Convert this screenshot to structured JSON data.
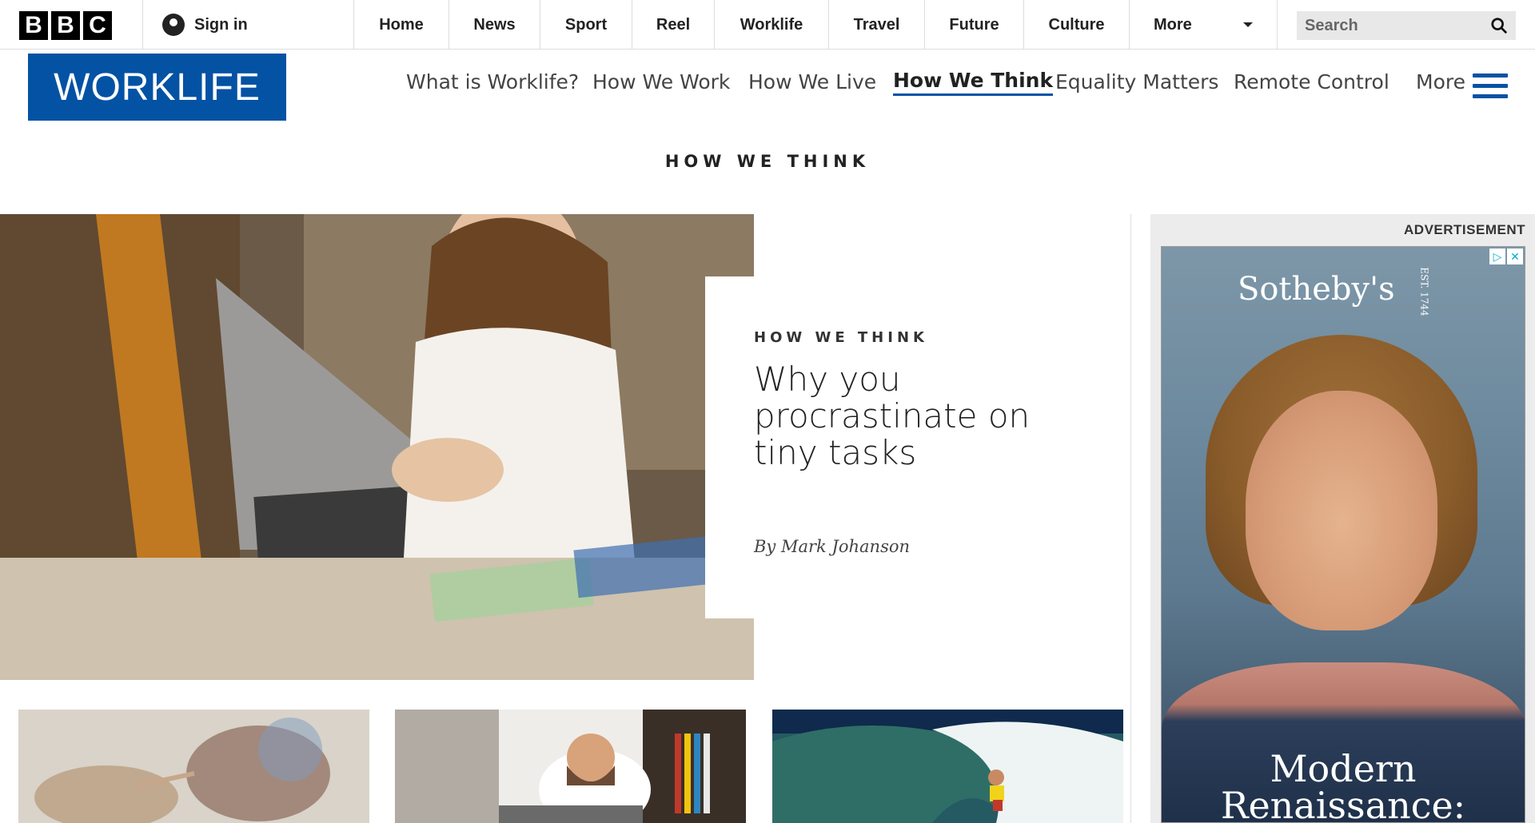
{
  "bbc_bar": {
    "logo_letters": [
      "B",
      "B",
      "C"
    ],
    "sign_in": "Sign in",
    "nav": [
      "Home",
      "News",
      "Sport",
      "Reel",
      "Worklife",
      "Travel",
      "Future",
      "Culture"
    ],
    "more": "More",
    "search_placeholder": "Search"
  },
  "worklife": {
    "logo": "WORKLIFE",
    "nav": [
      {
        "label": "What is Worklife?",
        "active": false
      },
      {
        "label": "How We Work",
        "active": false
      },
      {
        "label": "How We Live",
        "active": false
      },
      {
        "label": "How We Think",
        "active": true
      },
      {
        "label": "Equality Matters",
        "active": false
      },
      {
        "label": "Remote Control",
        "active": false
      }
    ],
    "more": "More"
  },
  "section_title": "HOW WE THINK",
  "feature": {
    "kicker": "HOW WE THINK",
    "title": "Why you procrastinate on tiny tasks",
    "byline": "By Mark Johanson"
  },
  "ad": {
    "label": "ADVERTISEMENT",
    "brand": "Sotheby's",
    "brand_est": "EST. 1744",
    "headline": "Modern Renaissance:"
  },
  "colors": {
    "worklife_blue": "#0452a4"
  }
}
